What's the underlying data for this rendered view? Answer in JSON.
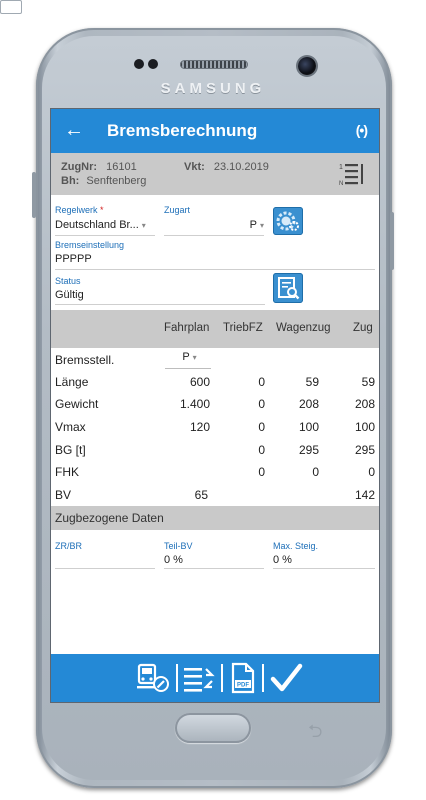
{
  "device": {
    "brand": "SAMSUNG"
  },
  "appbar": {
    "title": "Bremsberechnung",
    "back_icon": "arrow-left-icon",
    "broadcast_icon": "broadcast-icon"
  },
  "info": {
    "zugnr_label": "ZugNr:",
    "zugnr_value": "16101",
    "bh_label": "Bh:",
    "bh_value": "Senftenberg",
    "vkt_label": "Vkt:",
    "vkt_value": "23.10.2019"
  },
  "form": {
    "regelwerk_label": "Regelwerk",
    "regelwerk_required": "*",
    "regelwerk_value": "Deutschland Br...",
    "zugart_label": "Zugart",
    "zugart_value": "P",
    "bremseinstellung_label": "Bremseinstellung",
    "bremseinstellung_value": "PPPPP",
    "status_label": "Status",
    "status_value": "Gültig"
  },
  "table": {
    "headers": [
      "Fahrplan",
      "TriebFZ",
      "Wagenzug",
      "Zug"
    ],
    "bremsstell_label": "Bremsstell.",
    "bremsstell_value": "P",
    "rows": [
      {
        "label": "Länge",
        "fahrplan": "600",
        "triebfz": "0",
        "wagenzug": "59",
        "zug": "59"
      },
      {
        "label": "Gewicht",
        "fahrplan": "1.400",
        "triebfz": "0",
        "wagenzug": "208",
        "zug": "208"
      },
      {
        "label": "Vmax",
        "fahrplan": "120",
        "triebfz": "0",
        "wagenzug": "100",
        "zug": "100"
      },
      {
        "label": "BG [t]",
        "fahrplan": "",
        "triebfz": "0",
        "wagenzug": "295",
        "zug": "295"
      },
      {
        "label": "FHK",
        "fahrplan": "",
        "triebfz": "0",
        "wagenzug": "0",
        "zug": "0"
      },
      {
        "label": "BV",
        "fahrplan": "65",
        "triebfz": "",
        "wagenzug": "",
        "zug": "142"
      }
    ]
  },
  "zugbezogene": {
    "title": "Zugbezogene Daten",
    "zrbr_label": "ZR/BR",
    "zrbr_value": "",
    "teilbv_label": "Teil-BV",
    "teilbv_value": "0 %",
    "maxsteig_label": "Max. Steig.",
    "maxsteig_value": "0 %"
  },
  "bottom_bar": {
    "icons": [
      "train-edit-icon",
      "list-sync-icon",
      "pdf-document-icon",
      "checkmark-icon"
    ],
    "pdf_text": "PDF"
  },
  "colors": {
    "primary": "#2489d6",
    "header_gray": "#c9c9c9",
    "label_blue": "#1e6fb8",
    "required": "#d21d1d"
  }
}
